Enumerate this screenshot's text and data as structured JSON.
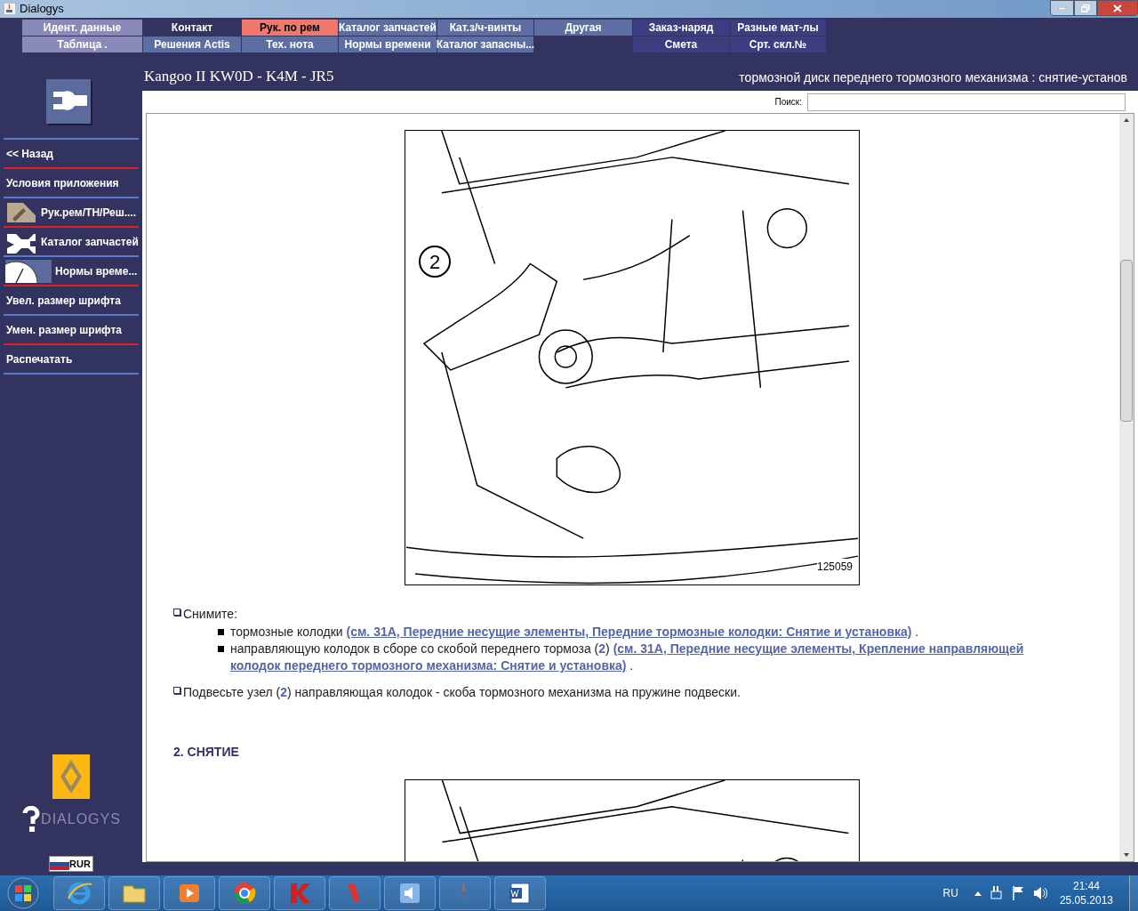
{
  "window": {
    "title": "Dialogys"
  },
  "nav_columns": [
    {
      "top": {
        "label": "Идент. данные",
        "kind": "light",
        "selected": false
      },
      "bottom": {
        "label": "Таблица .",
        "kind": "light",
        "selected": false
      }
    },
    {
      "top": {
        "label": "Контакт",
        "kind": "dark",
        "selected": false
      },
      "bottom": {
        "label": "Решения Actis",
        "kind": "medium",
        "selected": false
      }
    },
    {
      "top": {
        "label": "Рук. по рем",
        "kind": "medium",
        "selected": true
      },
      "bottom": {
        "label": "Тех. нота",
        "kind": "medium",
        "selected": false
      }
    },
    {
      "top": {
        "label": "Каталог запчастей",
        "kind": "medium",
        "selected": false
      },
      "bottom": {
        "label": "Нормы времени",
        "kind": "medium",
        "selected": false
      }
    },
    {
      "top": {
        "label": "Кат.з/ч-винты",
        "kind": "medium",
        "selected": false
      },
      "bottom": {
        "label": "Каталог запасны...",
        "kind": "medium",
        "selected": false
      }
    },
    {
      "top": {
        "label": "Другая",
        "kind": "medium",
        "selected": false
      }
    },
    {
      "top": {
        "label": "Заказ-наряд",
        "kind": "navy",
        "selected": false
      },
      "bottom": {
        "label": "Смета",
        "kind": "navy",
        "selected": false
      }
    },
    {
      "top": {
        "label": "Разные мат-лы",
        "kind": "navy",
        "selected": false
      },
      "bottom": {
        "label": "Срт. скл.№",
        "kind": "navy",
        "selected": false
      }
    }
  ],
  "header": {
    "vehicle": "Kangoo II KW0D - K4M - JR5",
    "operation": "тормозной диск переднего тормозного механизма : снятие-установ"
  },
  "search": {
    "label": "Поиск:"
  },
  "sidebar": {
    "items": [
      {
        "label": "<< Назад",
        "kind": "text"
      },
      {
        "label": "Условия приложения",
        "kind": "text"
      },
      {
        "label": "Рук.рем/ТН/Реш....",
        "kind": "manual"
      },
      {
        "label": "Каталог запчастей",
        "kind": "parts"
      },
      {
        "label": "Нормы време...",
        "kind": "clock"
      },
      {
        "label": "Увел. размер шрифта",
        "kind": "text"
      },
      {
        "label": "Умен. размер шрифта",
        "kind": "text"
      },
      {
        "label": "Распечатать",
        "kind": "text"
      }
    ],
    "brand": "DIALOGYS",
    "currency": "RUR"
  },
  "figure": {
    "callout": "2",
    "number": "125059"
  },
  "steps": [
    {
      "text": "Снимите:",
      "items": [
        {
          "text": "тормозные колодки ",
          "link_lines": [
            "(см. 31A, Передние несущие элементы, Передние тормозные колодки: Снятие и установка)"
          ],
          "after": " ."
        },
        {
          "text": "направляющую колодок в сборе со скобой переднего тормоза (**2**) ",
          "link_lines": [
            "(см. 31A, Передние несущие элементы, Крепление направляющей",
            "колодок переднего тормозного механизма: Снятие и установка)"
          ],
          "after": " ."
        }
      ]
    },
    {
      "text": "Подвесьте узел (**2**) направляющая колодок - скоба тормозного механизма на пружине подвески."
    }
  ],
  "section_heading": "2. СНЯТИЕ",
  "taskbar": {
    "apps": [
      {
        "kind": "ie"
      },
      {
        "kind": "folder"
      },
      {
        "kind": "media"
      },
      {
        "kind": "chrome"
      },
      {
        "kind": "antivirus"
      },
      {
        "kind": "yandex"
      },
      {
        "kind": "speaker"
      },
      {
        "kind": "java"
      },
      {
        "kind": "word"
      }
    ],
    "language": "RU",
    "time": "21:44",
    "date": "25.05.2013"
  }
}
